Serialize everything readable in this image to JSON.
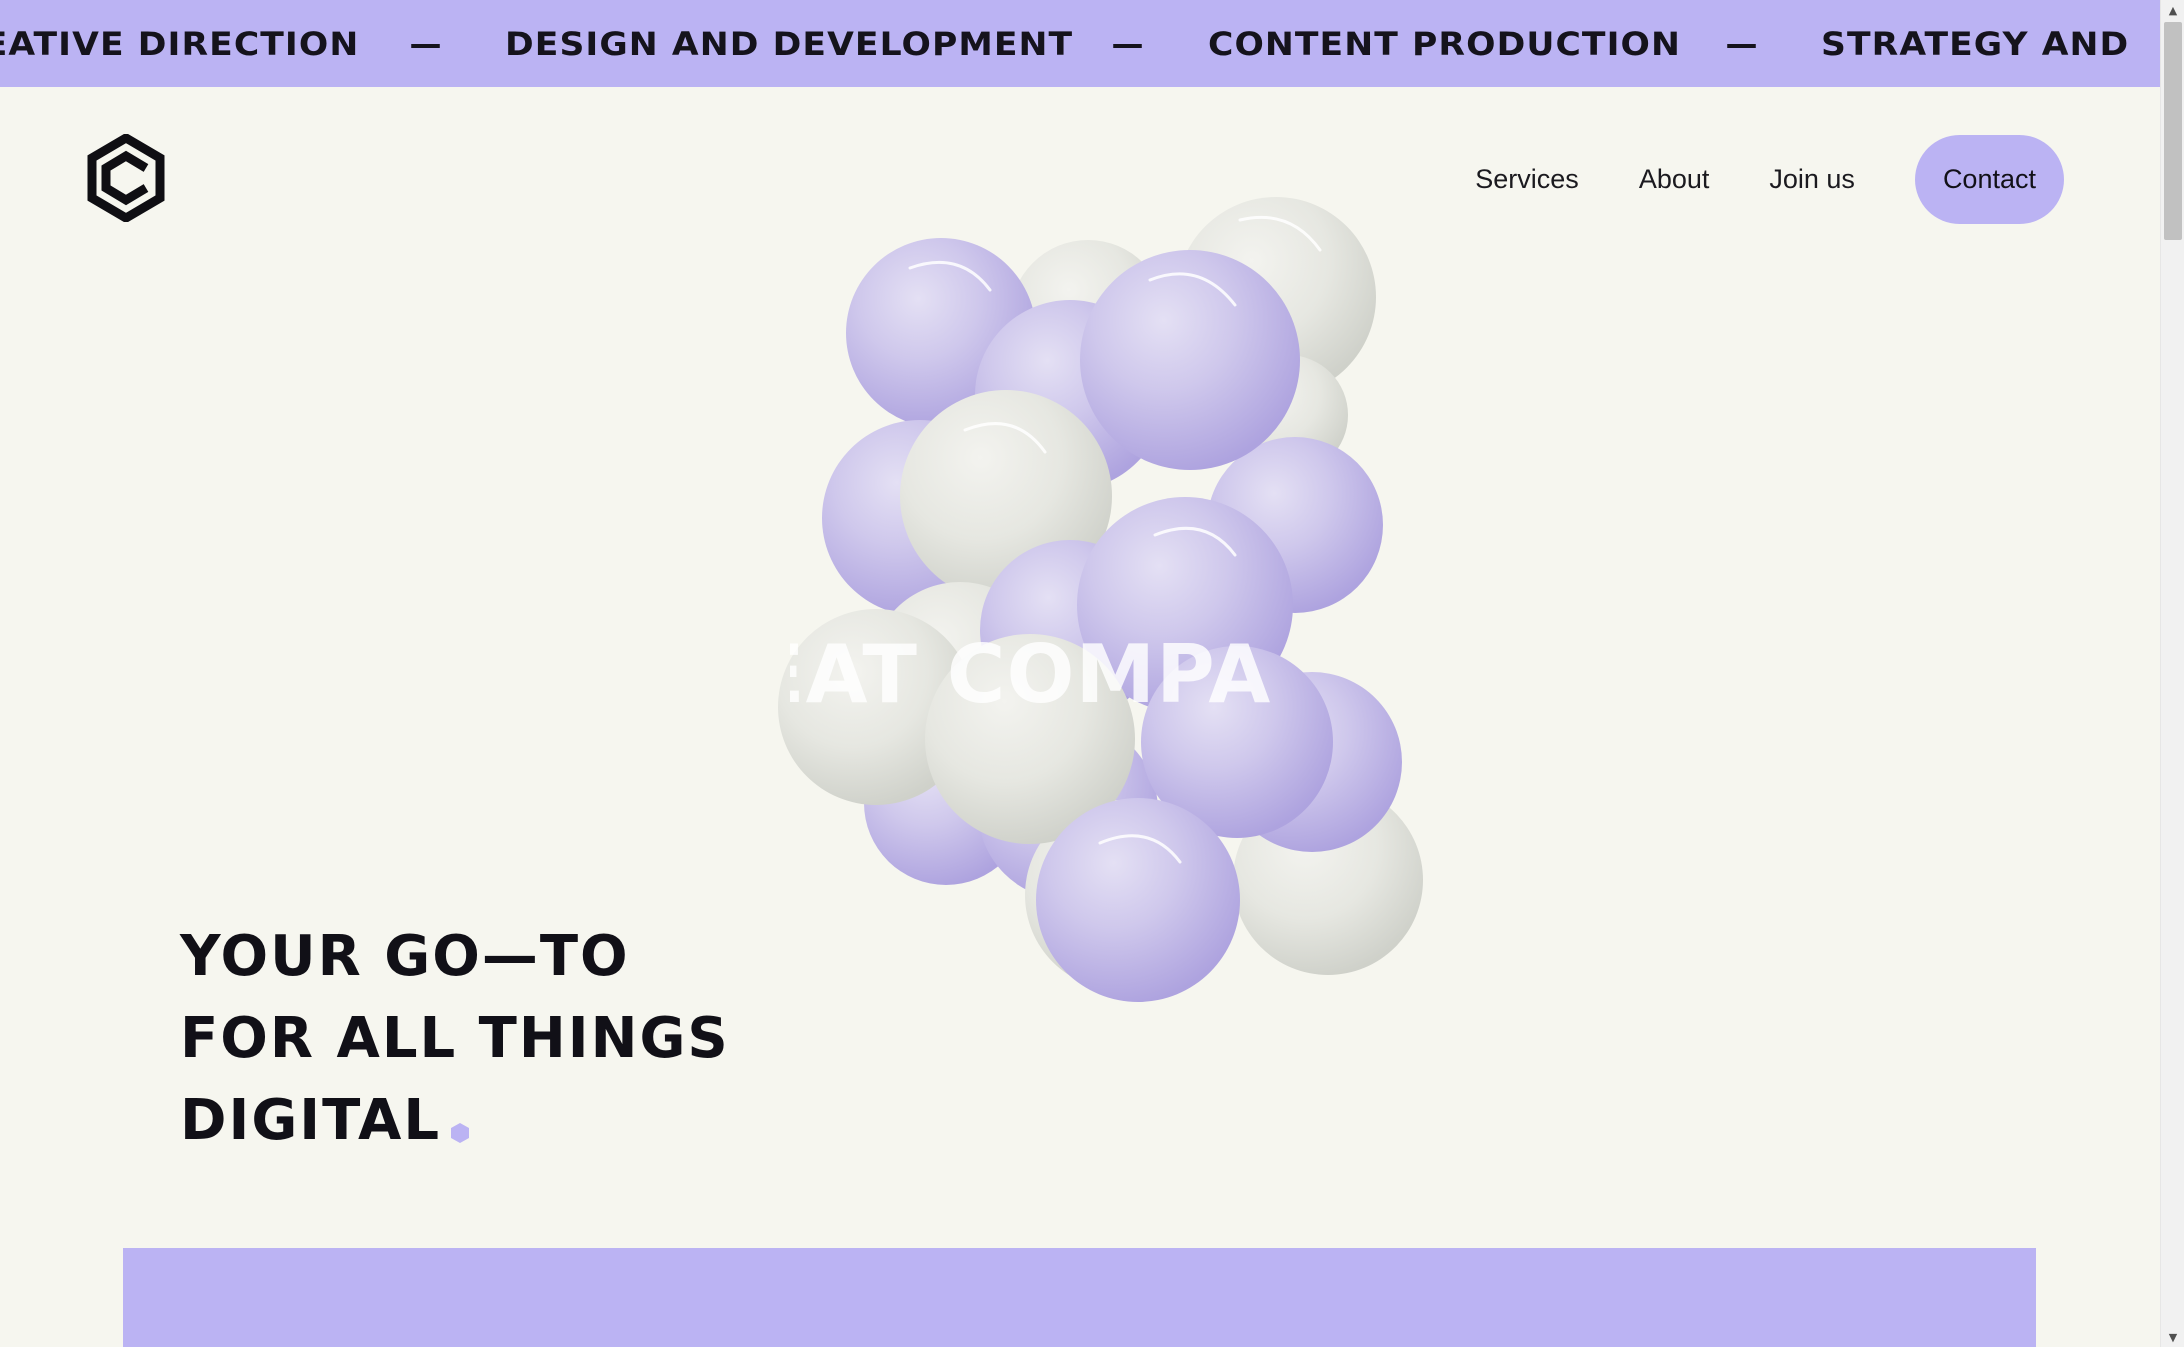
{
  "marquee": {
    "items": [
      "REATIVE DIRECTION",
      "DESIGN AND DEVELOPMENT",
      "CONTENT PRODUCTION",
      "STRATEGY AND"
    ],
    "separator": "—"
  },
  "header": {
    "logo_icon": "hexagon-c-logo-icon",
    "nav": {
      "services": "Services",
      "about": "About",
      "join": "Join us",
      "contact": "Contact"
    }
  },
  "hero": {
    "overlay_text": "EAT COMPA",
    "headline": [
      "YOUR GO—TO",
      "FOR ALL THINGS",
      "DIGITAL"
    ],
    "accent_icon": "hexagon-dot-icon",
    "balls_image": "lavender-and-white-spheres-cluster"
  },
  "colors": {
    "accent": "#bbb3f3",
    "background": "#f6f6ef",
    "text": "#111017"
  }
}
